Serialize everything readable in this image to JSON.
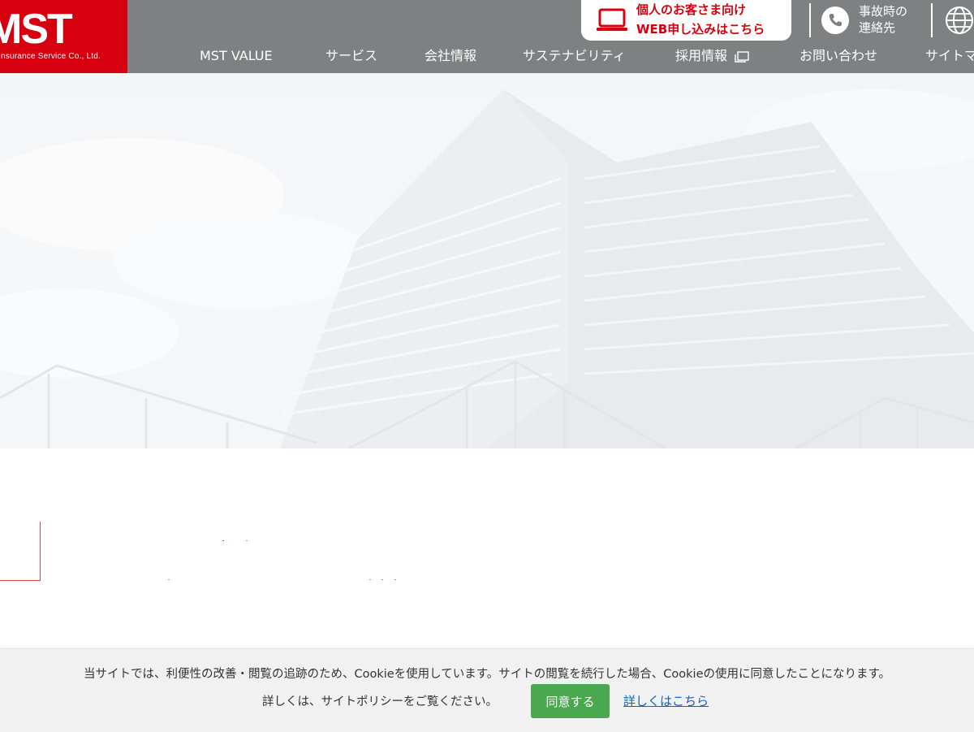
{
  "header": {
    "logo_mark": "MST",
    "logo_sub": "Insurance Service Co., Ltd.",
    "brand_color": "#d7000f",
    "header_bg": "#7f8081",
    "web_apply": {
      "line1": "個人のお客さま向け",
      "line2": "WEB申し込みはこちら",
      "icon": "laptop-icon"
    },
    "accident": {
      "line1": "事故時の",
      "line2": "連絡先",
      "icon": "phone-icon"
    },
    "language_icon": "globe-icon"
  },
  "nav": {
    "items": [
      {
        "label": "MST VALUE"
      },
      {
        "label": "サービス"
      },
      {
        "label": "会社情報"
      },
      {
        "label": "サステナビリティ"
      },
      {
        "label": "採用情報",
        "icon": "external-window-icon"
      },
      {
        "label": "お問い合わせ"
      },
      {
        "label": "サイトマ"
      }
    ]
  },
  "cookie": {
    "message": "当サイトでは、利便性の改善・閲覧の追跡のため、Cookieを使用しています。サイトの閲覧を続行した場合、Cookieの使用に同意したことになります。",
    "detail_text": "詳しくは、サイトポリシーをご覧ください。",
    "agree_label": "同意する",
    "agree_color": "#4aa84e",
    "link_label": "詳しくはこちら"
  }
}
